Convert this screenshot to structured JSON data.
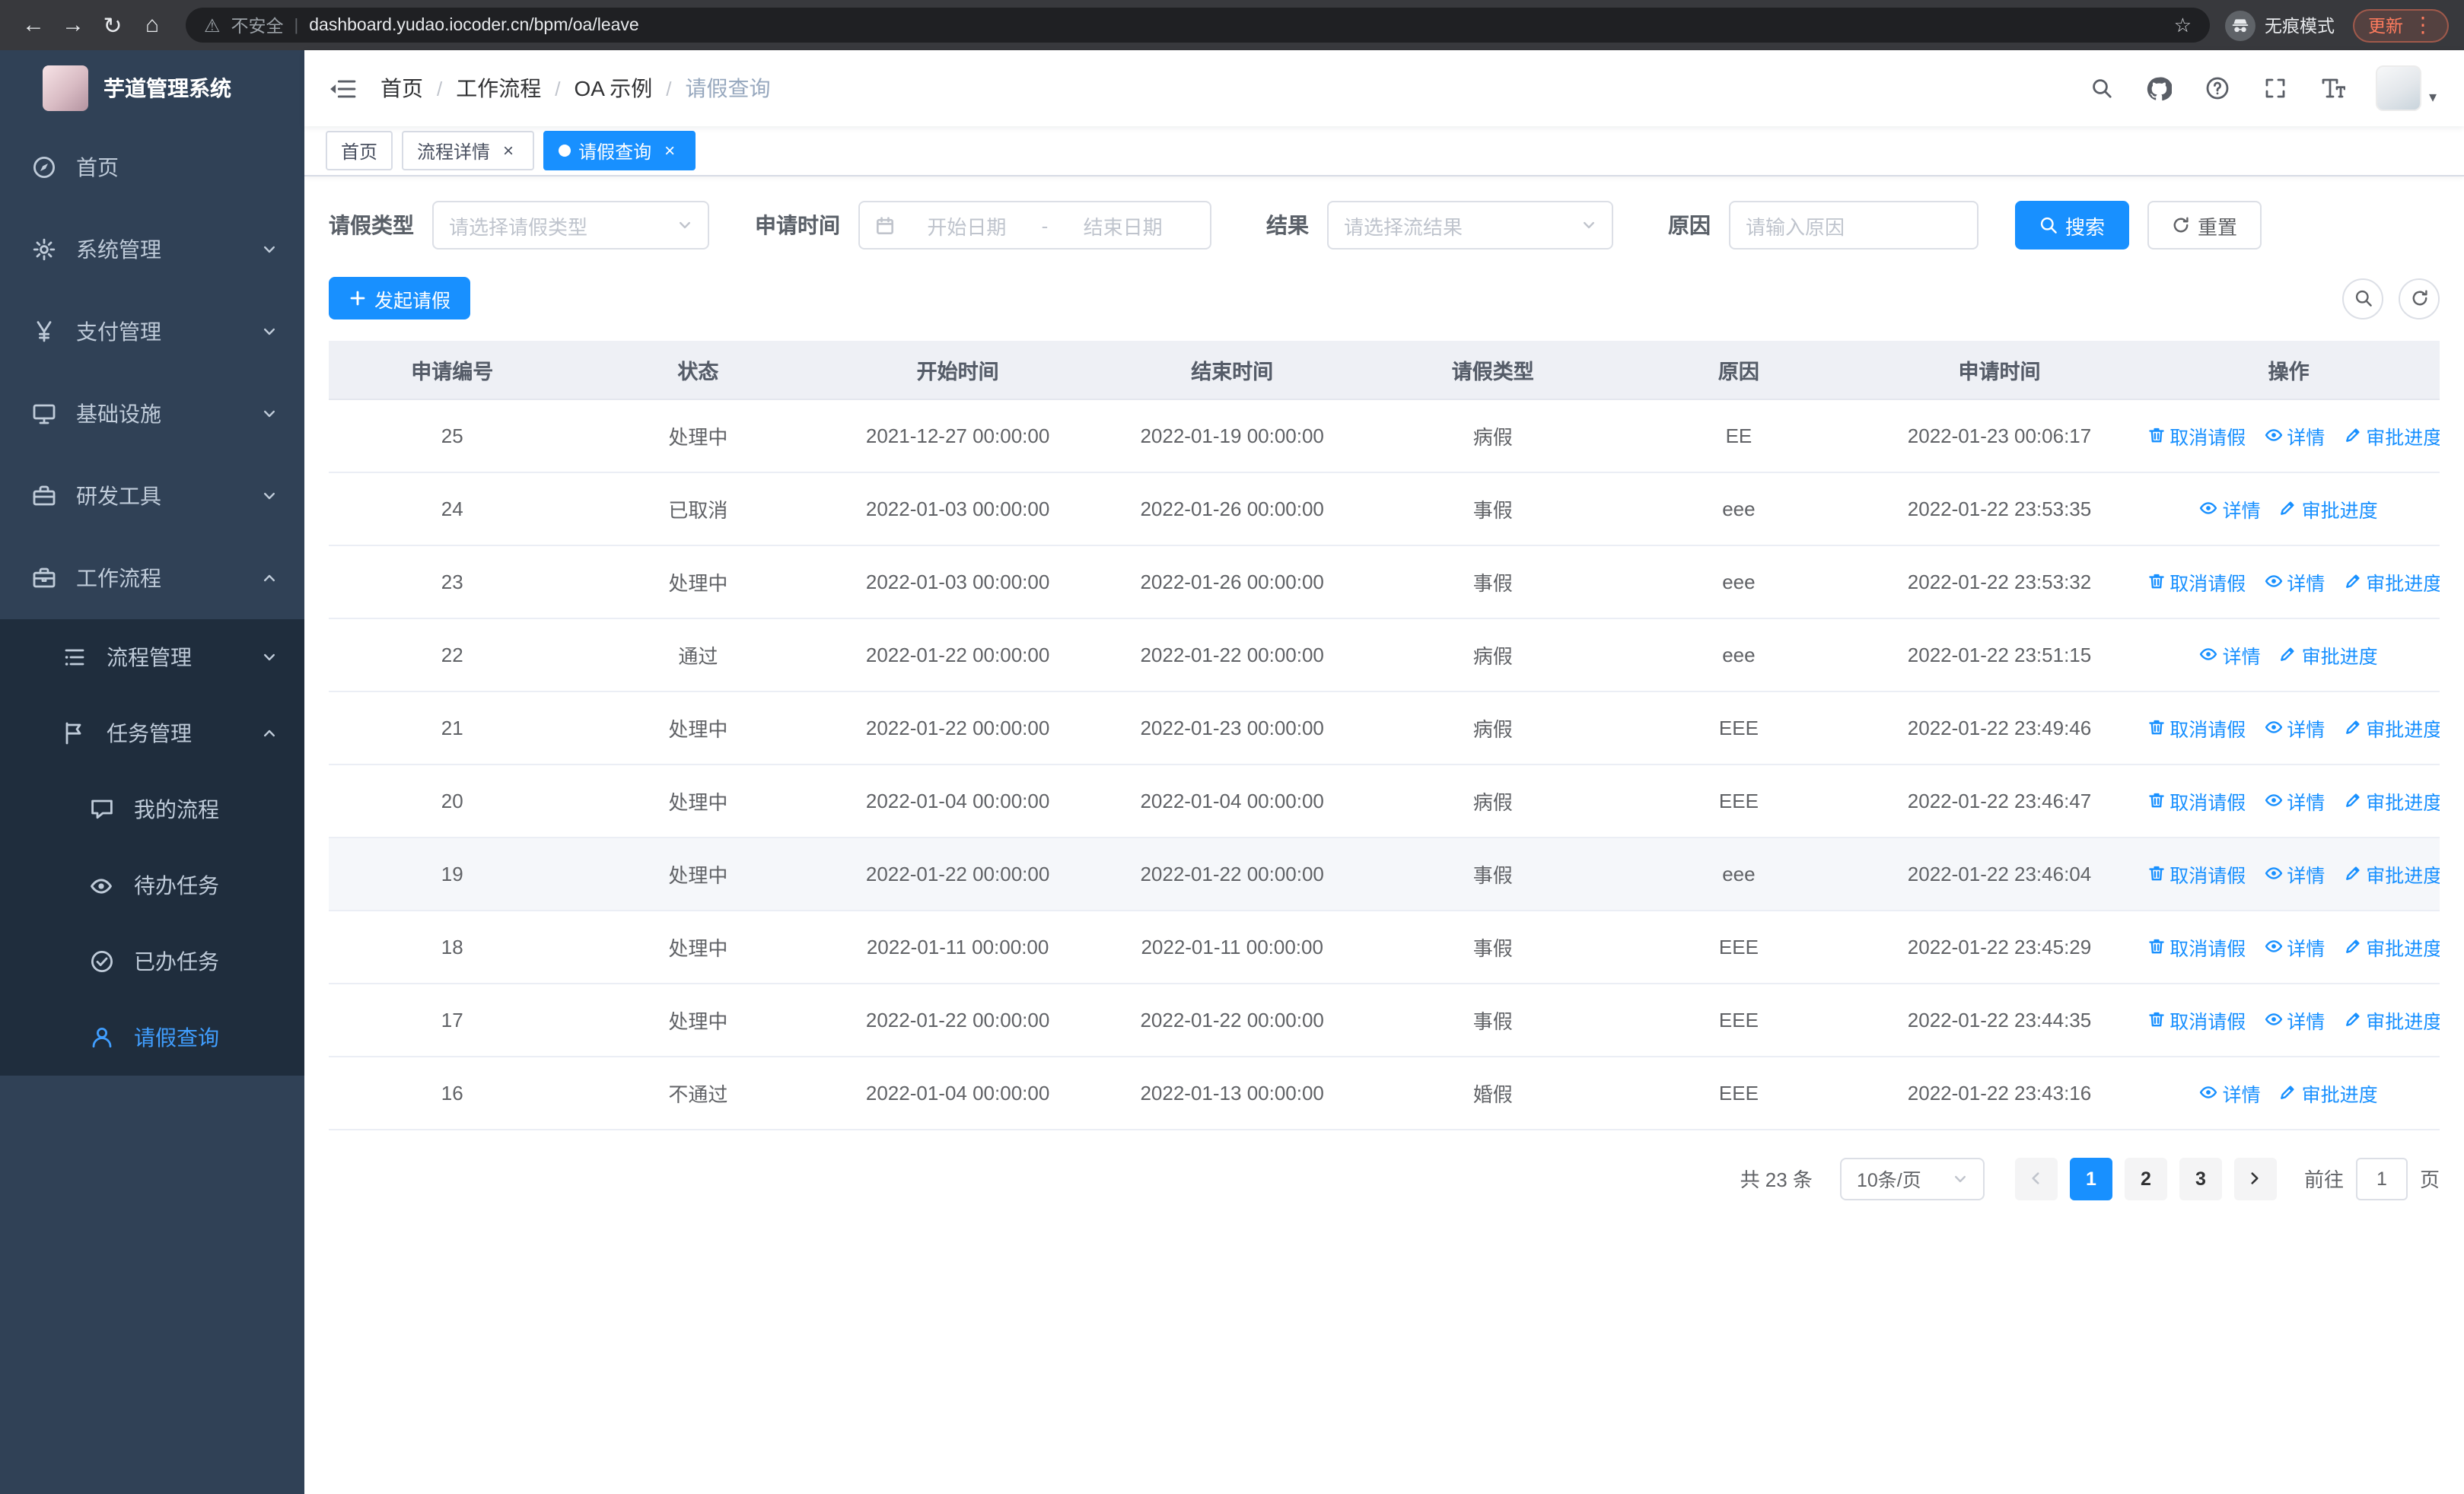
{
  "browser": {
    "security_warning": "不安全",
    "url": "dashboard.yudao.iocoder.cn/bpm/oa/leave",
    "incognito_label": "无痕模式",
    "update_label": "更新"
  },
  "sidebar": {
    "title": "芋道管理系统",
    "menu": [
      {
        "name": "home",
        "label": "首页",
        "icon": "dashboard-icon",
        "level": 1
      },
      {
        "name": "system-mgmt",
        "label": "系统管理",
        "icon": "gear-icon",
        "level": 1,
        "chevron": "down"
      },
      {
        "name": "payment-mgmt",
        "label": "支付管理",
        "icon": "yen-icon",
        "level": 1,
        "chevron": "down"
      },
      {
        "name": "infrastructure",
        "label": "基础设施",
        "icon": "monitor-icon",
        "level": 1,
        "chevron": "down"
      },
      {
        "name": "dev-tools",
        "label": "研发工具",
        "icon": "toolbox-icon",
        "level": 1,
        "chevron": "down"
      },
      {
        "name": "workflow",
        "label": "工作流程",
        "icon": "briefcase-icon",
        "level": 1,
        "chevron": "up"
      },
      {
        "name": "process-mgmt",
        "label": "流程管理",
        "icon": "flow-icon",
        "level": 2,
        "chevron": "down"
      },
      {
        "name": "task-mgmt",
        "label": "任务管理",
        "icon": "tasks-icon",
        "level": 2,
        "chevron": "up"
      },
      {
        "name": "my-processes",
        "label": "我的流程",
        "icon": "chat-icon",
        "level": 3
      },
      {
        "name": "todo-tasks",
        "label": "待办任务",
        "icon": "eye-icon",
        "level": 3
      },
      {
        "name": "done-tasks",
        "label": "已办任务",
        "icon": "done-icon",
        "level": 3
      },
      {
        "name": "leave-query",
        "label": "请假查询",
        "icon": "user-icon",
        "level": 3,
        "active": true
      }
    ]
  },
  "header": {
    "breadcrumb": [
      "首页",
      "工作流程",
      "OA 示例",
      "请假查询"
    ],
    "right_icons": [
      {
        "name": "search-icon"
      },
      {
        "name": "github-icon"
      },
      {
        "name": "question-icon"
      },
      {
        "name": "fullscreen-icon"
      },
      {
        "name": "fontsize-icon"
      }
    ]
  },
  "tabs": [
    {
      "name": "home",
      "label": "首页"
    },
    {
      "name": "process-detail",
      "label": "流程详情",
      "closable": true
    },
    {
      "name": "leave-query",
      "label": "请假查询",
      "closable": true,
      "active": true
    }
  ],
  "filters": {
    "leave_type_label": "请假类型",
    "leave_type_placeholder": "请选择请假类型",
    "apply_time_label": "申请时间",
    "start_date_placeholder": "开始日期",
    "date_separator": "-",
    "end_date_placeholder": "结束日期",
    "result_label": "结果",
    "result_placeholder": "请选择流结果",
    "reason_label": "原因",
    "reason_placeholder": "请输入原因",
    "search_label": "搜索",
    "reset_label": "重置"
  },
  "toolbar": {
    "create_label": "发起请假"
  },
  "table": {
    "columns": [
      "申请编号",
      "状态",
      "开始时间",
      "结束时间",
      "请假类型",
      "原因",
      "申请时间",
      "操作"
    ],
    "ops_labels": {
      "cancel": "取消请假",
      "detail": "详情",
      "progress": "审批进度"
    },
    "rows": [
      {
        "id": "25",
        "status": "处理中",
        "start": "2021-12-27 00:00:00",
        "end": "2022-01-19 00:00:00",
        "type": "病假",
        "reason": "EE",
        "applied": "2022-01-23 00:06:17",
        "ops": [
          "cancel",
          "detail",
          "progress"
        ]
      },
      {
        "id": "24",
        "status": "已取消",
        "start": "2022-01-03 00:00:00",
        "end": "2022-01-26 00:00:00",
        "type": "事假",
        "reason": "eee",
        "applied": "2022-01-22 23:53:35",
        "ops": [
          "detail",
          "progress"
        ]
      },
      {
        "id": "23",
        "status": "处理中",
        "start": "2022-01-03 00:00:00",
        "end": "2022-01-26 00:00:00",
        "type": "事假",
        "reason": "eee",
        "applied": "2022-01-22 23:53:32",
        "ops": [
          "cancel",
          "detail",
          "progress"
        ]
      },
      {
        "id": "22",
        "status": "通过",
        "start": "2022-01-22 00:00:00",
        "end": "2022-01-22 00:00:00",
        "type": "病假",
        "reason": "eee",
        "applied": "2022-01-22 23:51:15",
        "ops": [
          "detail",
          "progress"
        ]
      },
      {
        "id": "21",
        "status": "处理中",
        "start": "2022-01-22 00:00:00",
        "end": "2022-01-23 00:00:00",
        "type": "病假",
        "reason": "EEE",
        "applied": "2022-01-22 23:49:46",
        "ops": [
          "cancel",
          "detail",
          "progress"
        ]
      },
      {
        "id": "20",
        "status": "处理中",
        "start": "2022-01-04 00:00:00",
        "end": "2022-01-04 00:00:00",
        "type": "病假",
        "reason": "EEE",
        "applied": "2022-01-22 23:46:47",
        "ops": [
          "cancel",
          "detail",
          "progress"
        ]
      },
      {
        "id": "19",
        "status": "处理中",
        "start": "2022-01-22 00:00:00",
        "end": "2022-01-22 00:00:00",
        "type": "事假",
        "reason": "eee",
        "applied": "2022-01-22 23:46:04",
        "ops": [
          "cancel",
          "detail",
          "progress"
        ],
        "hover": true
      },
      {
        "id": "18",
        "status": "处理中",
        "start": "2022-01-11 00:00:00",
        "end": "2022-01-11 00:00:00",
        "type": "事假",
        "reason": "EEE",
        "applied": "2022-01-22 23:45:29",
        "ops": [
          "cancel",
          "detail",
          "progress"
        ]
      },
      {
        "id": "17",
        "status": "处理中",
        "start": "2022-01-22 00:00:00",
        "end": "2022-01-22 00:00:00",
        "type": "事假",
        "reason": "EEE",
        "applied": "2022-01-22 23:44:35",
        "ops": [
          "cancel",
          "detail",
          "progress"
        ]
      },
      {
        "id": "16",
        "status": "不通过",
        "start": "2022-01-04 00:00:00",
        "end": "2022-01-13 00:00:00",
        "type": "婚假",
        "reason": "EEE",
        "applied": "2022-01-22 23:43:16",
        "ops": [
          "detail",
          "progress"
        ]
      }
    ]
  },
  "pagination": {
    "total_label": "共 23 条",
    "page_size": "10条/页",
    "pages": [
      "1",
      "2",
      "3"
    ],
    "active_page": "1",
    "goto_label": "前往",
    "goto_value": "1",
    "page_unit": "页"
  },
  "colors": {
    "primary": "#1890ff",
    "sidebar_bg": "#304156",
    "submenu_bg": "#1f2d3d",
    "menu_active_text": "#409eff",
    "active_tab_bg": "#1890ff"
  }
}
